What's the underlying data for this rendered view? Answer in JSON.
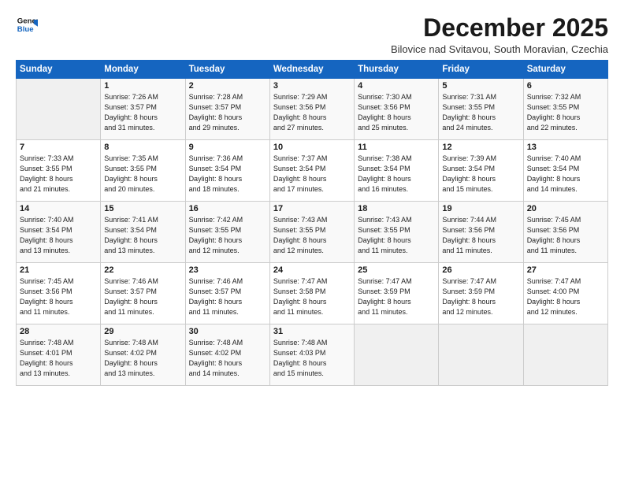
{
  "logo": {
    "line1": "General",
    "line2": "Blue"
  },
  "title": "December 2025",
  "subtitle": "Bilovice nad Svitavou, South Moravian, Czechia",
  "days_of_week": [
    "Sunday",
    "Monday",
    "Tuesday",
    "Wednesday",
    "Thursday",
    "Friday",
    "Saturday"
  ],
  "weeks": [
    [
      {
        "num": "",
        "info": ""
      },
      {
        "num": "1",
        "info": "Sunrise: 7:26 AM\nSunset: 3:57 PM\nDaylight: 8 hours\nand 31 minutes."
      },
      {
        "num": "2",
        "info": "Sunrise: 7:28 AM\nSunset: 3:57 PM\nDaylight: 8 hours\nand 29 minutes."
      },
      {
        "num": "3",
        "info": "Sunrise: 7:29 AM\nSunset: 3:56 PM\nDaylight: 8 hours\nand 27 minutes."
      },
      {
        "num": "4",
        "info": "Sunrise: 7:30 AM\nSunset: 3:56 PM\nDaylight: 8 hours\nand 25 minutes."
      },
      {
        "num": "5",
        "info": "Sunrise: 7:31 AM\nSunset: 3:55 PM\nDaylight: 8 hours\nand 24 minutes."
      },
      {
        "num": "6",
        "info": "Sunrise: 7:32 AM\nSunset: 3:55 PM\nDaylight: 8 hours\nand 22 minutes."
      }
    ],
    [
      {
        "num": "7",
        "info": "Sunrise: 7:33 AM\nSunset: 3:55 PM\nDaylight: 8 hours\nand 21 minutes."
      },
      {
        "num": "8",
        "info": "Sunrise: 7:35 AM\nSunset: 3:55 PM\nDaylight: 8 hours\nand 20 minutes."
      },
      {
        "num": "9",
        "info": "Sunrise: 7:36 AM\nSunset: 3:54 PM\nDaylight: 8 hours\nand 18 minutes."
      },
      {
        "num": "10",
        "info": "Sunrise: 7:37 AM\nSunset: 3:54 PM\nDaylight: 8 hours\nand 17 minutes."
      },
      {
        "num": "11",
        "info": "Sunrise: 7:38 AM\nSunset: 3:54 PM\nDaylight: 8 hours\nand 16 minutes."
      },
      {
        "num": "12",
        "info": "Sunrise: 7:39 AM\nSunset: 3:54 PM\nDaylight: 8 hours\nand 15 minutes."
      },
      {
        "num": "13",
        "info": "Sunrise: 7:40 AM\nSunset: 3:54 PM\nDaylight: 8 hours\nand 14 minutes."
      }
    ],
    [
      {
        "num": "14",
        "info": "Sunrise: 7:40 AM\nSunset: 3:54 PM\nDaylight: 8 hours\nand 13 minutes."
      },
      {
        "num": "15",
        "info": "Sunrise: 7:41 AM\nSunset: 3:54 PM\nDaylight: 8 hours\nand 13 minutes."
      },
      {
        "num": "16",
        "info": "Sunrise: 7:42 AM\nSunset: 3:55 PM\nDaylight: 8 hours\nand 12 minutes."
      },
      {
        "num": "17",
        "info": "Sunrise: 7:43 AM\nSunset: 3:55 PM\nDaylight: 8 hours\nand 12 minutes."
      },
      {
        "num": "18",
        "info": "Sunrise: 7:43 AM\nSunset: 3:55 PM\nDaylight: 8 hours\nand 11 minutes."
      },
      {
        "num": "19",
        "info": "Sunrise: 7:44 AM\nSunset: 3:56 PM\nDaylight: 8 hours\nand 11 minutes."
      },
      {
        "num": "20",
        "info": "Sunrise: 7:45 AM\nSunset: 3:56 PM\nDaylight: 8 hours\nand 11 minutes."
      }
    ],
    [
      {
        "num": "21",
        "info": "Sunrise: 7:45 AM\nSunset: 3:56 PM\nDaylight: 8 hours\nand 11 minutes."
      },
      {
        "num": "22",
        "info": "Sunrise: 7:46 AM\nSunset: 3:57 PM\nDaylight: 8 hours\nand 11 minutes."
      },
      {
        "num": "23",
        "info": "Sunrise: 7:46 AM\nSunset: 3:57 PM\nDaylight: 8 hours\nand 11 minutes."
      },
      {
        "num": "24",
        "info": "Sunrise: 7:47 AM\nSunset: 3:58 PM\nDaylight: 8 hours\nand 11 minutes."
      },
      {
        "num": "25",
        "info": "Sunrise: 7:47 AM\nSunset: 3:59 PM\nDaylight: 8 hours\nand 11 minutes."
      },
      {
        "num": "26",
        "info": "Sunrise: 7:47 AM\nSunset: 3:59 PM\nDaylight: 8 hours\nand 12 minutes."
      },
      {
        "num": "27",
        "info": "Sunrise: 7:47 AM\nSunset: 4:00 PM\nDaylight: 8 hours\nand 12 minutes."
      }
    ],
    [
      {
        "num": "28",
        "info": "Sunrise: 7:48 AM\nSunset: 4:01 PM\nDaylight: 8 hours\nand 13 minutes."
      },
      {
        "num": "29",
        "info": "Sunrise: 7:48 AM\nSunset: 4:02 PM\nDaylight: 8 hours\nand 13 minutes."
      },
      {
        "num": "30",
        "info": "Sunrise: 7:48 AM\nSunset: 4:02 PM\nDaylight: 8 hours\nand 14 minutes."
      },
      {
        "num": "31",
        "info": "Sunrise: 7:48 AM\nSunset: 4:03 PM\nDaylight: 8 hours\nand 15 minutes."
      },
      {
        "num": "",
        "info": ""
      },
      {
        "num": "",
        "info": ""
      },
      {
        "num": "",
        "info": ""
      }
    ]
  ]
}
